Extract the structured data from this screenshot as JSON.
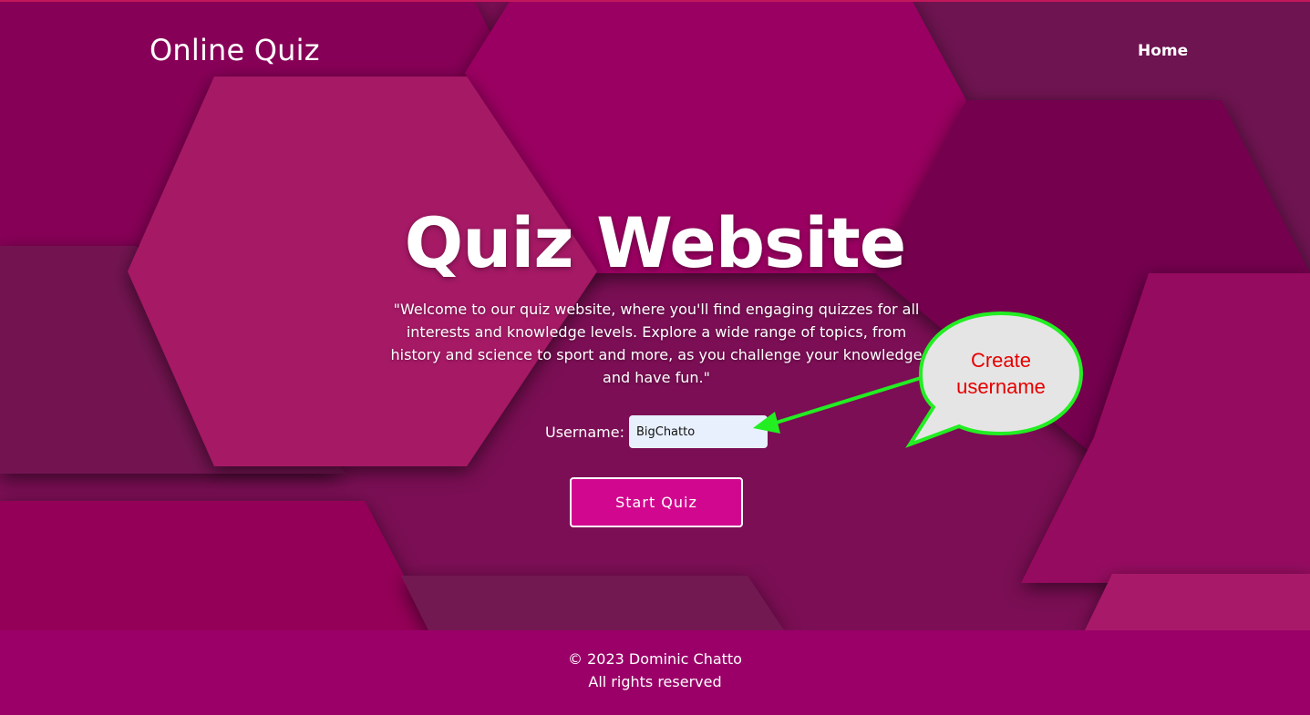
{
  "header": {
    "brand": "Online Quiz",
    "nav": {
      "home_label": "Home"
    }
  },
  "hero": {
    "title": "Quiz Website",
    "description": "\"Welcome to our quiz website, where you'll find engaging quizzes for all interests and knowledge levels. Explore a wide range of topics, from history and science to sport and more, as you challenge your knowledge and have fun.\""
  },
  "form": {
    "username_label": "Username:",
    "username_value": "BigChatto",
    "start_button_label": "Start Quiz"
  },
  "annotation": {
    "callout_text": "Create username",
    "arrow_color": "#22ee22",
    "text_color": "#e60000"
  },
  "footer": {
    "copyright": "© 2023 Dominic Chatto",
    "rights": "All rights reserved"
  },
  "colors": {
    "background": "#8a0a5e",
    "hexagon_light": "#b31d6e",
    "button_bg": "#d1088f",
    "footer_bg": "#9b0068",
    "input_bg": "#e8f0fe"
  }
}
